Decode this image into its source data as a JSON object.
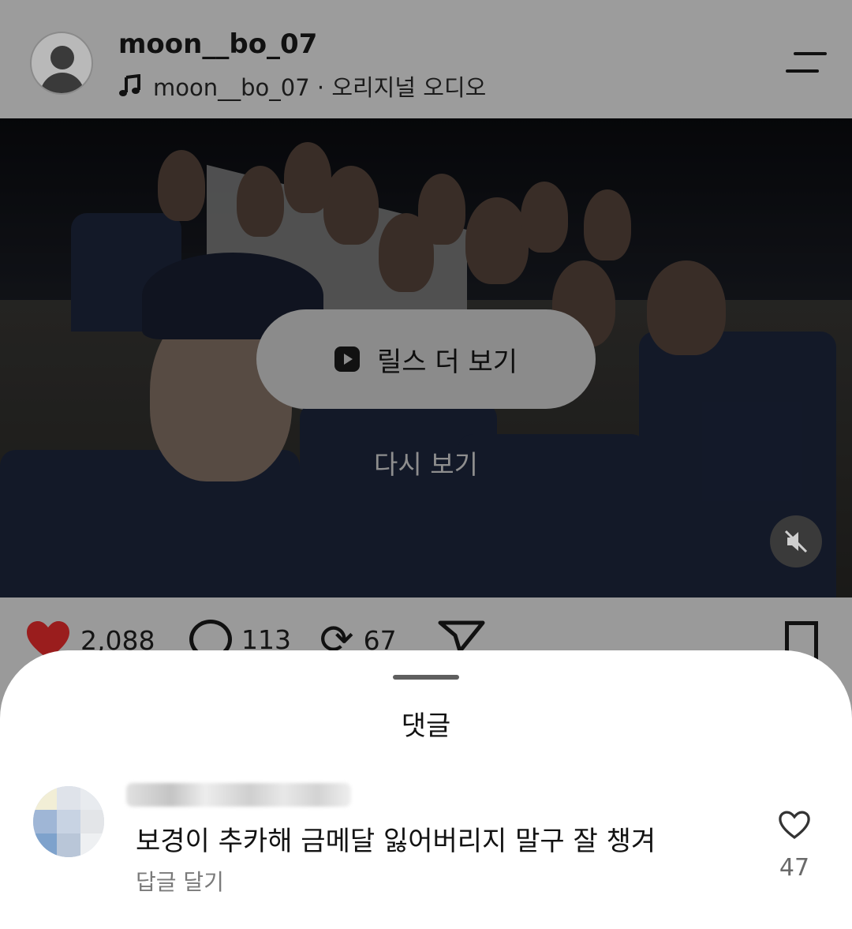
{
  "post": {
    "username": "moon__bo_07",
    "audio": "moon__bo_07 · 오리지널 오디오"
  },
  "video": {
    "reels_button_label": "릴스 더 보기",
    "replay_label": "다시 보기"
  },
  "actions": {
    "likes": "2,088",
    "comments": "113",
    "reposts": "67"
  },
  "comments_sheet": {
    "title": "댓글",
    "comments": [
      {
        "text": "보경이 추카해 금메달 잃어버리지 말구 잘 챙겨",
        "reply_label": "답글 달기",
        "like_count": "47"
      }
    ]
  }
}
